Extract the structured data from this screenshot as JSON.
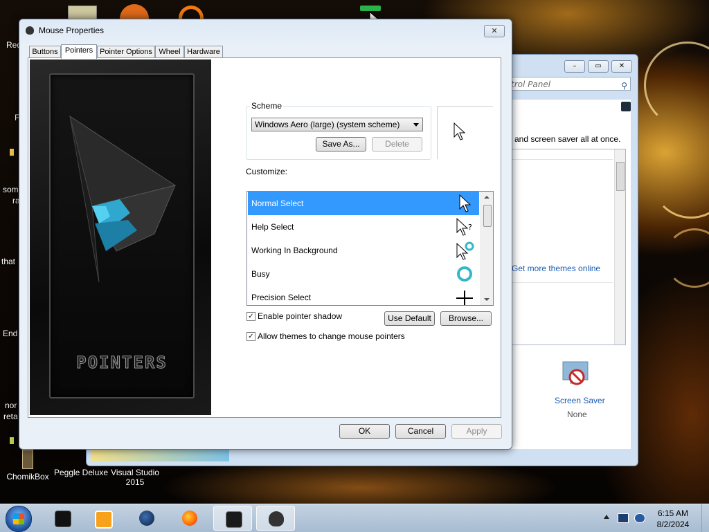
{
  "desktop": {
    "icons": [
      {
        "label": "ChomikBox"
      },
      {
        "label": "Peggle Deluxe"
      },
      {
        "label": "Visual Studio 2015"
      }
    ],
    "edge_fragments": [
      "Red",
      "F",
      "som",
      "ra",
      "that",
      "End",
      "nor",
      "reta"
    ]
  },
  "control_panel": {
    "search_placeholder": "trol Panel",
    "text_line": "and screen saver all at once.",
    "link_more_themes": "Get more themes online",
    "screen_saver_label": "Screen Saver",
    "screen_saver_value": "None",
    "title_btns": [
      "–",
      "▭",
      "✕"
    ]
  },
  "dialog": {
    "title": "Mouse Properties",
    "close_glyph": "✕",
    "tabs": [
      {
        "label": "Buttons",
        "active": false
      },
      {
        "label": "Pointers",
        "active": true
      },
      {
        "label": "Pointer Options",
        "active": false
      },
      {
        "label": "Wheel",
        "active": false
      },
      {
        "label": "Hardware",
        "active": false
      }
    ],
    "side_art_text": "POINTERS",
    "scheme": {
      "group_label": "Scheme",
      "selected": "Windows Aero (large) (system scheme)",
      "save_as": "Save As...",
      "delete": "Delete"
    },
    "customize_label": "Customize:",
    "pointers": [
      {
        "label": "Normal Select",
        "icon": "arrow-cursor-icon",
        "selected": true
      },
      {
        "label": "Help Select",
        "icon": "help-cursor-icon",
        "selected": false
      },
      {
        "label": "Working In Background",
        "icon": "working-cursor-icon",
        "selected": false
      },
      {
        "label": "Busy",
        "icon": "busy-cursor-icon",
        "selected": false
      },
      {
        "label": "Precision Select",
        "icon": "crosshair-cursor-icon",
        "selected": false
      }
    ],
    "enable_shadow": {
      "label": "Enable pointer shadow",
      "checked": true
    },
    "allow_themes": {
      "label": "Allow themes to change mouse pointers",
      "checked": true
    },
    "use_default": "Use Default",
    "browse": "Browse...",
    "ok": "OK",
    "cancel": "Cancel",
    "apply": "Apply",
    "check_glyph": "✓"
  },
  "taskbar": {
    "time": "6:15 AM",
    "date": "8/2/2024",
    "items": [
      "start-orb",
      "app-dark-icon",
      "media-player-icon",
      "globe-icon",
      "firefox-icon",
      "photo-viewer-icon",
      "mouse-icon"
    ]
  }
}
